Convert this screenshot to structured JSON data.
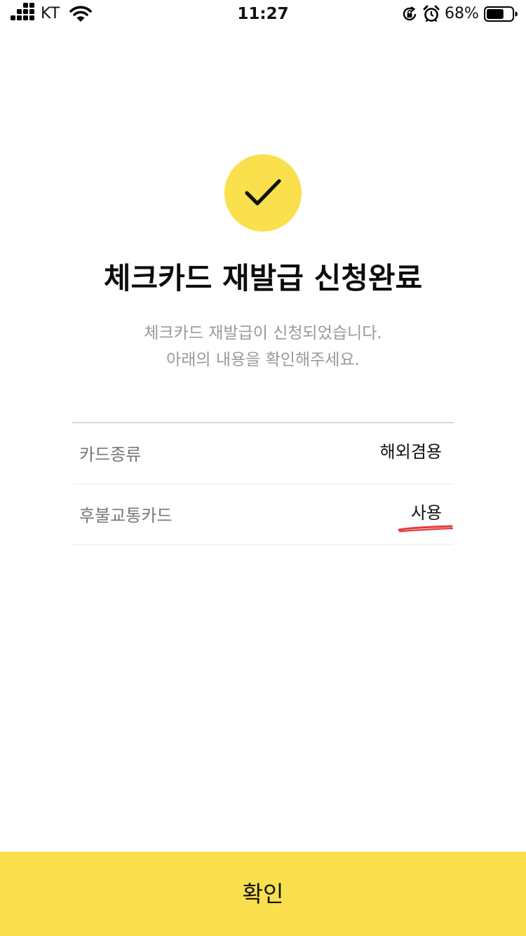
{
  "status_bar": {
    "carrier": "KT",
    "time": "11:27",
    "battery_percent": "68%",
    "battery_level": 0.68,
    "icons": [
      "signal-icon",
      "wifi-icon",
      "rotation-lock-icon",
      "alarm-icon",
      "battery-icon"
    ]
  },
  "success": {
    "icon": "checkmark-icon",
    "title": "체크카드 재발급 신청완료",
    "message_line1": "체크카드 재발급이 신청되었습니다.",
    "message_line2": "아래의 내용을 확인해주세요."
  },
  "details": [
    {
      "label": "카드종류",
      "value": "해외겸용"
    },
    {
      "label": "후불교통카드",
      "value": "사용"
    }
  ],
  "confirm_button": {
    "label": "확인"
  },
  "colors": {
    "accent_yellow": "#f9e04c",
    "annotation_red": "#e23b3b",
    "secondary_text": "#9a9a9a",
    "label_text": "#777777"
  }
}
